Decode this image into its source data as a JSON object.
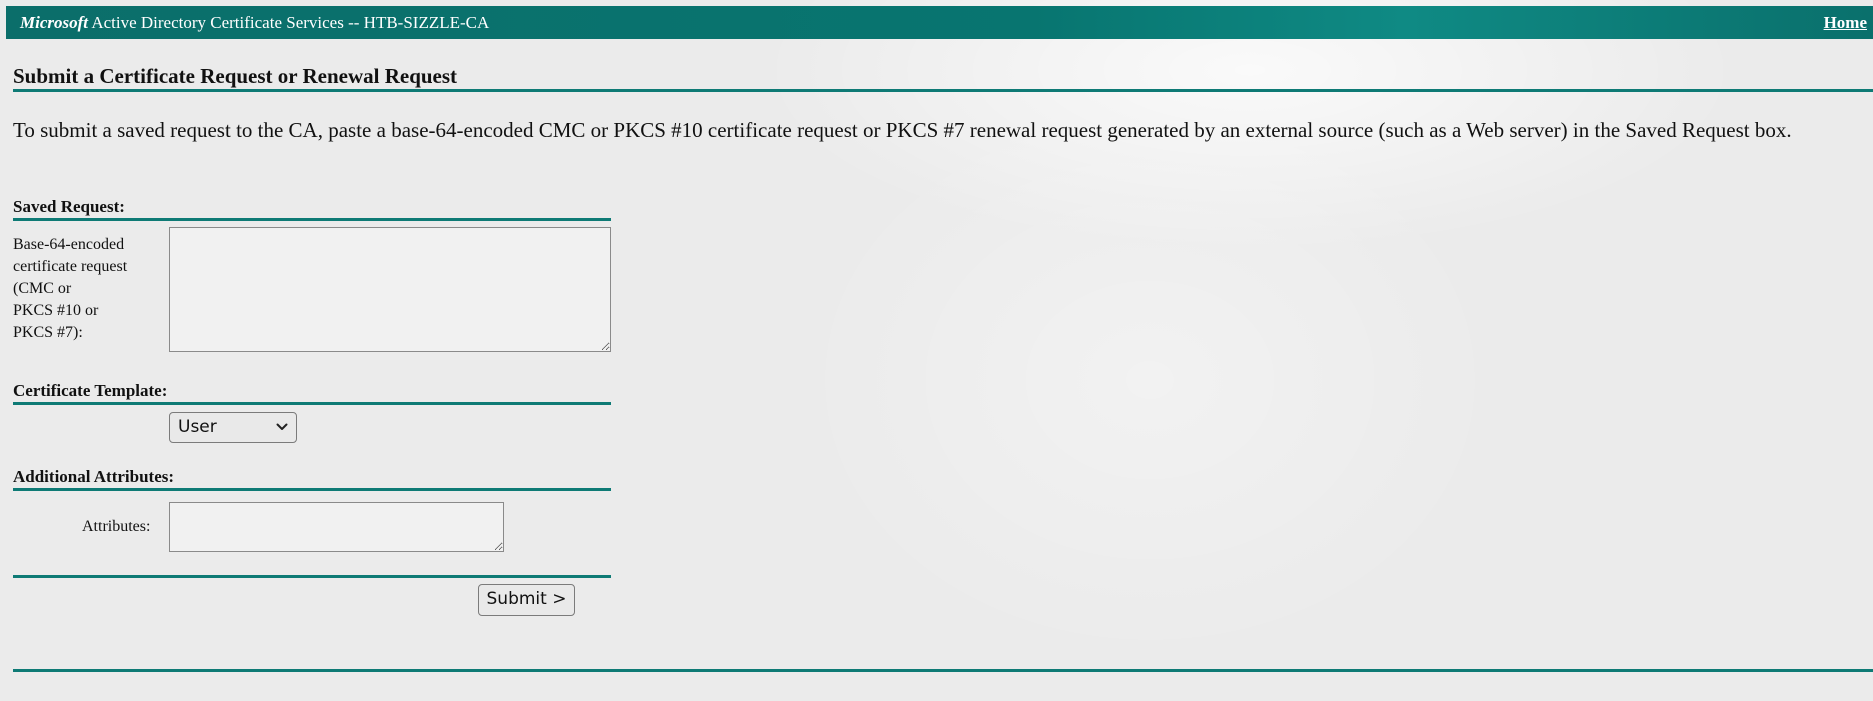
{
  "header": {
    "brand": "Microsoft",
    "product": "Active Directory Certificate Services",
    "separator": "--",
    "ca_name": "HTB-SIZZLE-CA",
    "home_link": "Home"
  },
  "main": {
    "title": "Submit a Certificate Request or Renewal Request",
    "intro": "To submit a saved request to the CA, paste a base-64-encoded CMC or PKCS #10 certificate request or PKCS #7 renewal request generated by an external source (such as a Web server) in the Saved Request box."
  },
  "saved_request": {
    "heading": "Saved Request:",
    "label_lines": [
      "Base-64-encoded",
      "certificate request",
      "(CMC or",
      "PKCS #10 or",
      "PKCS #7):"
    ],
    "value": ""
  },
  "certificate_template": {
    "heading": "Certificate Template:",
    "selected": "User"
  },
  "additional_attributes": {
    "heading": "Additional Attributes:",
    "label": "Attributes:",
    "value": ""
  },
  "actions": {
    "submit_label": "Submit >"
  },
  "colors": {
    "accent": "#0e7a75",
    "banner": "#087570",
    "background": "#ebebeb"
  },
  "icons": {
    "select_arrow": "chevron-down-icon"
  }
}
